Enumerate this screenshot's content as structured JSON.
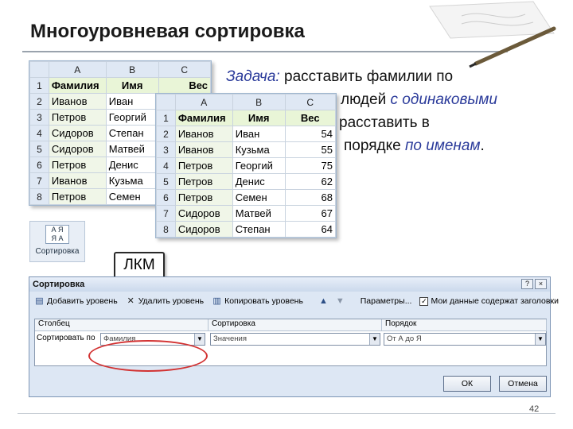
{
  "slide": {
    "title": "Многоуровневая сортировка",
    "page_number": "42"
  },
  "sheet1": {
    "columns": [
      "A",
      "B",
      "C"
    ],
    "header": [
      "Фамилия",
      "Имя",
      "Вес"
    ],
    "rows": [
      [
        "Иванов",
        "Иван",
        ""
      ],
      [
        "Петров",
        "Георгий",
        ""
      ],
      [
        "Сидоров",
        "Степан",
        ""
      ],
      [
        "Сидоров",
        "Матвей",
        ""
      ],
      [
        "Петров",
        "Денис",
        ""
      ],
      [
        "Иванов",
        "Кузьма",
        ""
      ],
      [
        "Петров",
        "Семен",
        ""
      ]
    ]
  },
  "sheet2": {
    "columns": [
      "A",
      "B",
      "C"
    ],
    "header": [
      "Фамилия",
      "Имя",
      "Вес"
    ],
    "rows": [
      [
        "Иванов",
        "Иван",
        "54"
      ],
      [
        "Иванов",
        "Кузьма",
        "55"
      ],
      [
        "Петров",
        "Георгий",
        "75"
      ],
      [
        "Петров",
        "Денис",
        "62"
      ],
      [
        "Петров",
        "Семен",
        "68"
      ],
      [
        "Сидоров",
        "Матвей",
        "67"
      ],
      [
        "Сидоров",
        "Степан",
        "64"
      ]
    ]
  },
  "task": {
    "label": "Задача:",
    "line1": "расставить фамилии по",
    "line2_pre": "людей ",
    "line2_em": "с одинаковыми",
    "line3": "расставить в",
    "line4_pre": "порядке ",
    "line4_em": "по именам",
    "line4_post": "."
  },
  "sort_button": {
    "label": "Сортировка",
    "icon_text": "А Я\nЯ А"
  },
  "callout": {
    "text": "ЛКМ"
  },
  "dialog": {
    "title": "Сортировка",
    "help_glyph": "?",
    "close_glyph": "×",
    "toolbar": {
      "add_level": "Добавить уровень",
      "delete_level": "Удалить уровень",
      "copy_level": "Копировать уровень",
      "params": "Параметры...",
      "headers_checkbox": "Мои данные содержат заголовки"
    },
    "columns": {
      "column": "Столбец",
      "sort_on": "Сортировка",
      "order": "Порядок"
    },
    "row_label": "Сортировать по",
    "column_value": "Фамилия",
    "sort_on_value": "Значения",
    "order_value": "От А до Я",
    "ok": "ОК",
    "cancel": "Отмена"
  }
}
